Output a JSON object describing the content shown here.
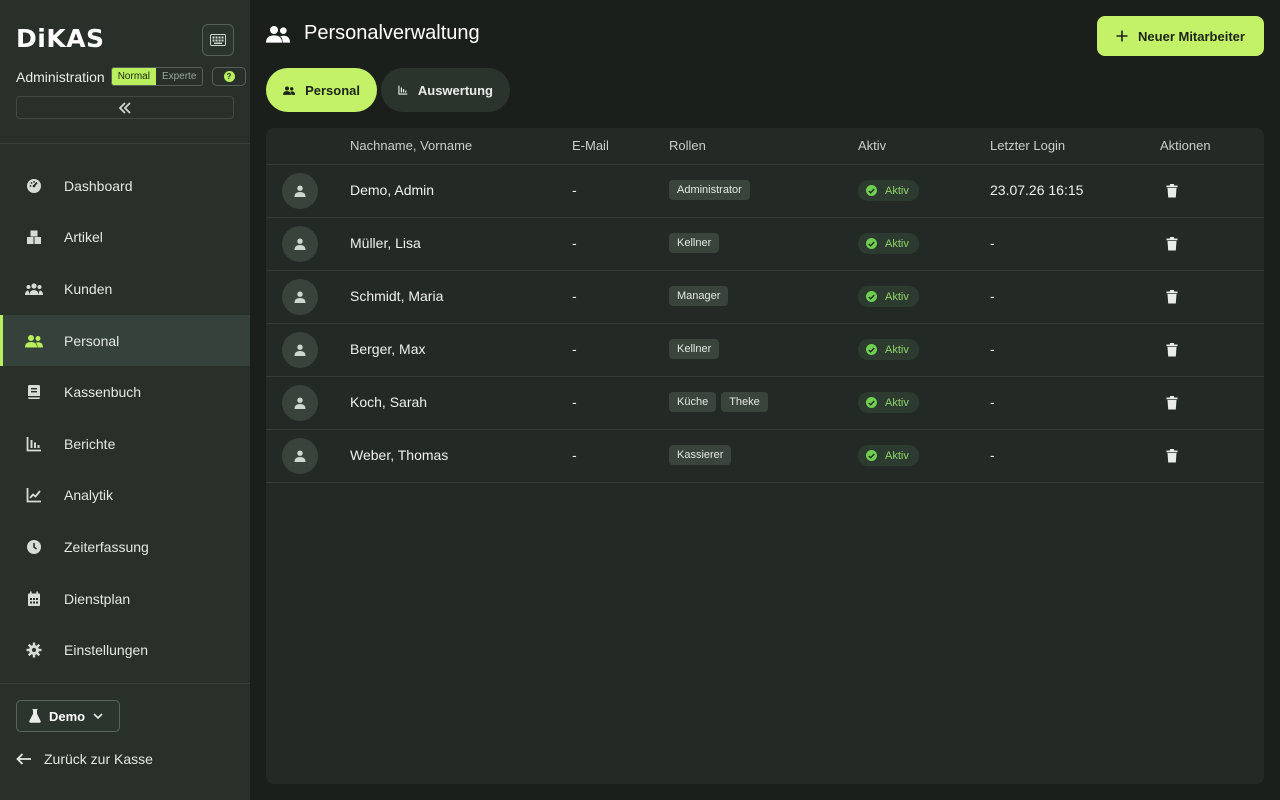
{
  "sidebar": {
    "logo": "DiKAS",
    "admin_label": "Administration",
    "mode_normal": "Normal",
    "mode_expert": "Experte",
    "help": "?",
    "nav": [
      {
        "label": "Dashboard",
        "icon": "dashboard-icon"
      },
      {
        "label": "Artikel",
        "icon": "boxes-icon"
      },
      {
        "label": "Kunden",
        "icon": "users-icon"
      },
      {
        "label": "Personal",
        "icon": "staff-icon",
        "active": true
      },
      {
        "label": "Kassenbuch",
        "icon": "book-icon"
      },
      {
        "label": "Berichte",
        "icon": "bar-chart-icon"
      },
      {
        "label": "Analytik",
        "icon": "line-chart-icon"
      },
      {
        "label": "Zeiterfassung",
        "icon": "clock-icon"
      },
      {
        "label": "Dienstplan",
        "icon": "calendar-icon"
      },
      {
        "label": "Einstellungen",
        "icon": "gear-icon"
      }
    ],
    "env_label": "Demo",
    "back_label": "Zurück zur Kasse"
  },
  "header": {
    "title": "Personalverwaltung",
    "new_button": "Neuer Mitarbeiter"
  },
  "tabs": [
    {
      "label": "Personal",
      "active": true
    },
    {
      "label": "Auswertung",
      "active": false
    }
  ],
  "table": {
    "columns": [
      "Nachname, Vorname",
      "E-Mail",
      "Rollen",
      "Aktiv",
      "Letzter Login",
      "Aktionen"
    ],
    "rows": [
      {
        "name": "Demo, Admin",
        "email": "-",
        "roles": [
          "Administrator"
        ],
        "status": "Aktiv",
        "last_login": "23.07.26 16:15"
      },
      {
        "name": "Müller, Lisa",
        "email": "-",
        "roles": [
          "Kellner"
        ],
        "status": "Aktiv",
        "last_login": "-"
      },
      {
        "name": "Schmidt, Maria",
        "email": "-",
        "roles": [
          "Manager"
        ],
        "status": "Aktiv",
        "last_login": "-"
      },
      {
        "name": "Berger, Max",
        "email": "-",
        "roles": [
          "Kellner"
        ],
        "status": "Aktiv",
        "last_login": "-"
      },
      {
        "name": "Koch, Sarah",
        "email": "-",
        "roles": [
          "Küche",
          "Theke"
        ],
        "status": "Aktiv",
        "last_login": "-"
      },
      {
        "name": "Weber, Thomas",
        "email": "-",
        "roles": [
          "Kassierer"
        ],
        "status": "Aktiv",
        "last_login": "-"
      }
    ]
  },
  "colors": {
    "accent": "#c3f268",
    "sidebar_bg": "#283029",
    "main_bg": "#1b1f1c",
    "status_green": "#6fcf4f"
  }
}
